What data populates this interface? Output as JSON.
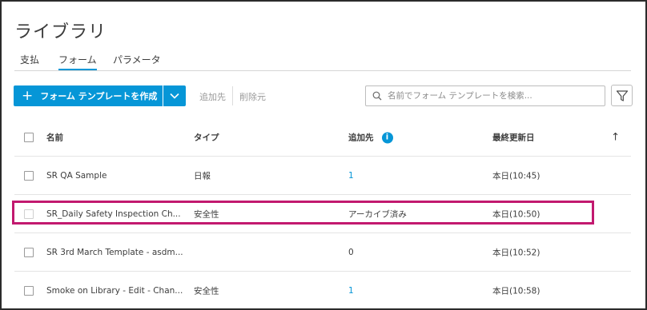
{
  "page": {
    "title": "ライブラリ"
  },
  "tabs": [
    {
      "label": "支払",
      "active": false
    },
    {
      "label": "フォーム",
      "active": true
    },
    {
      "label": "パラメータ",
      "active": false
    }
  ],
  "toolbar": {
    "create_label": "フォーム テンプレートを作成",
    "add_label": "追加先",
    "remove_label": "削除元",
    "search_placeholder": "名前でフォーム テンプレートを検索..."
  },
  "table": {
    "columns": {
      "name": "名前",
      "type": "タイプ",
      "added": "追加先",
      "updated": "最終更新日"
    },
    "rows": [
      {
        "name": "SR QA Sample",
        "type": "日報",
        "added": "1",
        "updated": "本日(10:45)"
      },
      {
        "name": "SR_Daily Safety Inspection Ch...",
        "type": "安全性",
        "added": "アーカイブ済み",
        "updated": "本日(10:50)"
      },
      {
        "name": "SR 3rd March Template - asdm...",
        "type": "",
        "added": "0",
        "updated": "本日(10:52)"
      },
      {
        "name": "Smoke on Library - Edit - Chan...",
        "type": "安全性",
        "added": "1",
        "updated": "本日(10:58)"
      }
    ]
  },
  "colors": {
    "accent": "#0696d7",
    "highlight": "#c2196f"
  },
  "icons": {
    "search": "search-icon",
    "filter": "filter-icon",
    "info": "info-icon",
    "sort": "sort-arrow-up-icon",
    "dropdown": "chevron-down-icon",
    "plus": "plus-icon"
  }
}
